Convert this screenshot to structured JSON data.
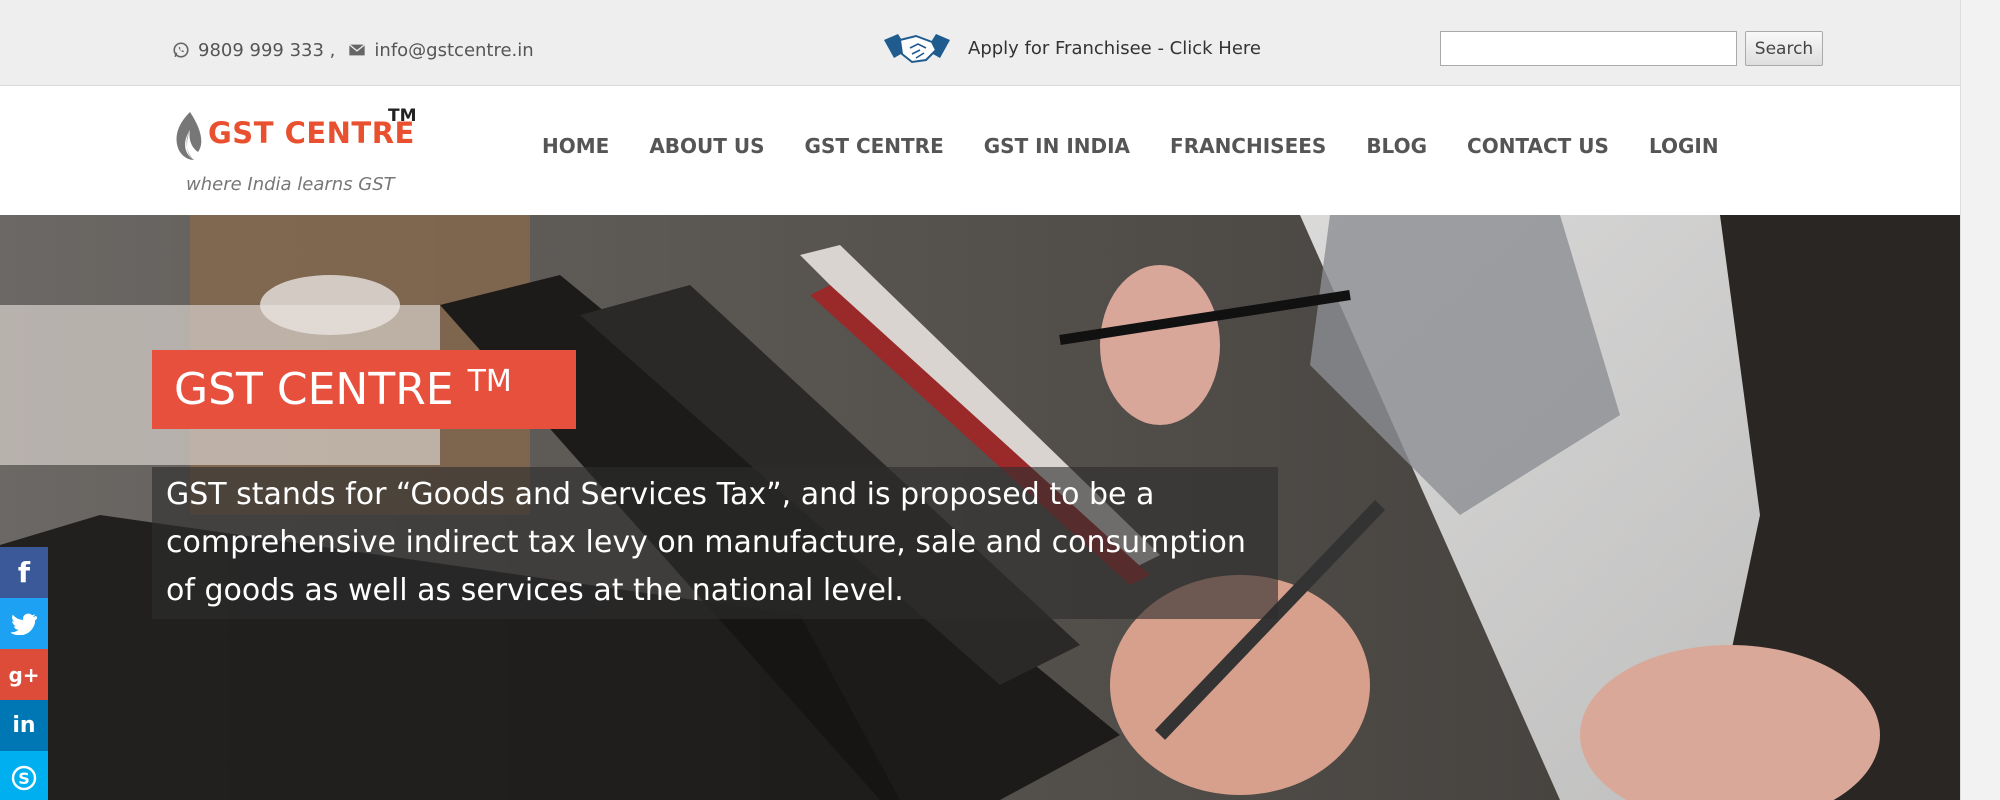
{
  "topbar": {
    "phone": "9809 999 333 ,",
    "email": "info@gstcentre.in",
    "franchise_label": "Apply for Franchisee - Click Here",
    "search_placeholder": "",
    "search_button": "Search",
    "icons": {
      "phone": "whatsapp-icon",
      "email": "envelope-icon",
      "franchise": "handshake-icon"
    }
  },
  "header": {
    "logo_brand": "GST CENTRE",
    "logo_tm": "TM",
    "logo_tagline": "where India learns GST",
    "nav": [
      "HOME",
      "ABOUT US",
      "GST CENTRE",
      "GST IN INDIA",
      "FRANCHISEES",
      "BLOG",
      "CONTACT US",
      "LOGIN"
    ]
  },
  "hero": {
    "title": "GST CENTRE",
    "title_tm": "TM",
    "text": "GST stands for “Goods and Services Tax”, and is proposed to be a comprehensive indirect tax levy on manufacture, sale and consumption of goods as well as services at the national level."
  },
  "social": [
    {
      "name": "facebook-icon",
      "glyph": "f"
    },
    {
      "name": "twitter-icon",
      "glyph": "🐦"
    },
    {
      "name": "google-plus-icon",
      "glyph": "g+"
    },
    {
      "name": "linkedin-icon",
      "glyph": "in"
    },
    {
      "name": "skype-icon",
      "glyph": "S"
    }
  ],
  "colors": {
    "accent": "#e8503e",
    "logo_orange": "#e8502f",
    "topbar_bg": "#eeeeee",
    "facebook": "#3b5998",
    "twitter": "#1da1f2",
    "google_plus": "#dd4b39",
    "linkedin": "#0077b5",
    "skype": "#00aff0"
  }
}
